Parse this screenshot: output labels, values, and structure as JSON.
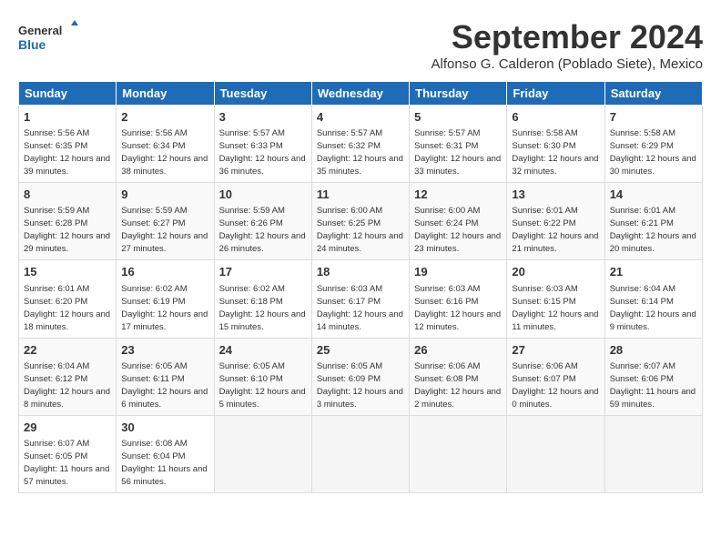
{
  "header": {
    "logo_line1": "General",
    "logo_line2": "Blue",
    "month": "September 2024",
    "location": "Alfonso G. Calderon (Poblado Siete), Mexico"
  },
  "days_of_week": [
    "Sunday",
    "Monday",
    "Tuesday",
    "Wednesday",
    "Thursday",
    "Friday",
    "Saturday"
  ],
  "weeks": [
    [
      {
        "day": "1",
        "sunrise": "Sunrise: 5:56 AM",
        "sunset": "Sunset: 6:35 PM",
        "daylight": "Daylight: 12 hours and 39 minutes."
      },
      {
        "day": "2",
        "sunrise": "Sunrise: 5:56 AM",
        "sunset": "Sunset: 6:34 PM",
        "daylight": "Daylight: 12 hours and 38 minutes."
      },
      {
        "day": "3",
        "sunrise": "Sunrise: 5:57 AM",
        "sunset": "Sunset: 6:33 PM",
        "daylight": "Daylight: 12 hours and 36 minutes."
      },
      {
        "day": "4",
        "sunrise": "Sunrise: 5:57 AM",
        "sunset": "Sunset: 6:32 PM",
        "daylight": "Daylight: 12 hours and 35 minutes."
      },
      {
        "day": "5",
        "sunrise": "Sunrise: 5:57 AM",
        "sunset": "Sunset: 6:31 PM",
        "daylight": "Daylight: 12 hours and 33 minutes."
      },
      {
        "day": "6",
        "sunrise": "Sunrise: 5:58 AM",
        "sunset": "Sunset: 6:30 PM",
        "daylight": "Daylight: 12 hours and 32 minutes."
      },
      {
        "day": "7",
        "sunrise": "Sunrise: 5:58 AM",
        "sunset": "Sunset: 6:29 PM",
        "daylight": "Daylight: 12 hours and 30 minutes."
      }
    ],
    [
      {
        "day": "8",
        "sunrise": "Sunrise: 5:59 AM",
        "sunset": "Sunset: 6:28 PM",
        "daylight": "Daylight: 12 hours and 29 minutes."
      },
      {
        "day": "9",
        "sunrise": "Sunrise: 5:59 AM",
        "sunset": "Sunset: 6:27 PM",
        "daylight": "Daylight: 12 hours and 27 minutes."
      },
      {
        "day": "10",
        "sunrise": "Sunrise: 5:59 AM",
        "sunset": "Sunset: 6:26 PM",
        "daylight": "Daylight: 12 hours and 26 minutes."
      },
      {
        "day": "11",
        "sunrise": "Sunrise: 6:00 AM",
        "sunset": "Sunset: 6:25 PM",
        "daylight": "Daylight: 12 hours and 24 minutes."
      },
      {
        "day": "12",
        "sunrise": "Sunrise: 6:00 AM",
        "sunset": "Sunset: 6:24 PM",
        "daylight": "Daylight: 12 hours and 23 minutes."
      },
      {
        "day": "13",
        "sunrise": "Sunrise: 6:01 AM",
        "sunset": "Sunset: 6:22 PM",
        "daylight": "Daylight: 12 hours and 21 minutes."
      },
      {
        "day": "14",
        "sunrise": "Sunrise: 6:01 AM",
        "sunset": "Sunset: 6:21 PM",
        "daylight": "Daylight: 12 hours and 20 minutes."
      }
    ],
    [
      {
        "day": "15",
        "sunrise": "Sunrise: 6:01 AM",
        "sunset": "Sunset: 6:20 PM",
        "daylight": "Daylight: 12 hours and 18 minutes."
      },
      {
        "day": "16",
        "sunrise": "Sunrise: 6:02 AM",
        "sunset": "Sunset: 6:19 PM",
        "daylight": "Daylight: 12 hours and 17 minutes."
      },
      {
        "day": "17",
        "sunrise": "Sunrise: 6:02 AM",
        "sunset": "Sunset: 6:18 PM",
        "daylight": "Daylight: 12 hours and 15 minutes."
      },
      {
        "day": "18",
        "sunrise": "Sunrise: 6:03 AM",
        "sunset": "Sunset: 6:17 PM",
        "daylight": "Daylight: 12 hours and 14 minutes."
      },
      {
        "day": "19",
        "sunrise": "Sunrise: 6:03 AM",
        "sunset": "Sunset: 6:16 PM",
        "daylight": "Daylight: 12 hours and 12 minutes."
      },
      {
        "day": "20",
        "sunrise": "Sunrise: 6:03 AM",
        "sunset": "Sunset: 6:15 PM",
        "daylight": "Daylight: 12 hours and 11 minutes."
      },
      {
        "day": "21",
        "sunrise": "Sunrise: 6:04 AM",
        "sunset": "Sunset: 6:14 PM",
        "daylight": "Daylight: 12 hours and 9 minutes."
      }
    ],
    [
      {
        "day": "22",
        "sunrise": "Sunrise: 6:04 AM",
        "sunset": "Sunset: 6:12 PM",
        "daylight": "Daylight: 12 hours and 8 minutes."
      },
      {
        "day": "23",
        "sunrise": "Sunrise: 6:05 AM",
        "sunset": "Sunset: 6:11 PM",
        "daylight": "Daylight: 12 hours and 6 minutes."
      },
      {
        "day": "24",
        "sunrise": "Sunrise: 6:05 AM",
        "sunset": "Sunset: 6:10 PM",
        "daylight": "Daylight: 12 hours and 5 minutes."
      },
      {
        "day": "25",
        "sunrise": "Sunrise: 6:05 AM",
        "sunset": "Sunset: 6:09 PM",
        "daylight": "Daylight: 12 hours and 3 minutes."
      },
      {
        "day": "26",
        "sunrise": "Sunrise: 6:06 AM",
        "sunset": "Sunset: 6:08 PM",
        "daylight": "Daylight: 12 hours and 2 minutes."
      },
      {
        "day": "27",
        "sunrise": "Sunrise: 6:06 AM",
        "sunset": "Sunset: 6:07 PM",
        "daylight": "Daylight: 12 hours and 0 minutes."
      },
      {
        "day": "28",
        "sunrise": "Sunrise: 6:07 AM",
        "sunset": "Sunset: 6:06 PM",
        "daylight": "Daylight: 11 hours and 59 minutes."
      }
    ],
    [
      {
        "day": "29",
        "sunrise": "Sunrise: 6:07 AM",
        "sunset": "Sunset: 6:05 PM",
        "daylight": "Daylight: 11 hours and 57 minutes."
      },
      {
        "day": "30",
        "sunrise": "Sunrise: 6:08 AM",
        "sunset": "Sunset: 6:04 PM",
        "daylight": "Daylight: 11 hours and 56 minutes."
      },
      null,
      null,
      null,
      null,
      null
    ]
  ]
}
